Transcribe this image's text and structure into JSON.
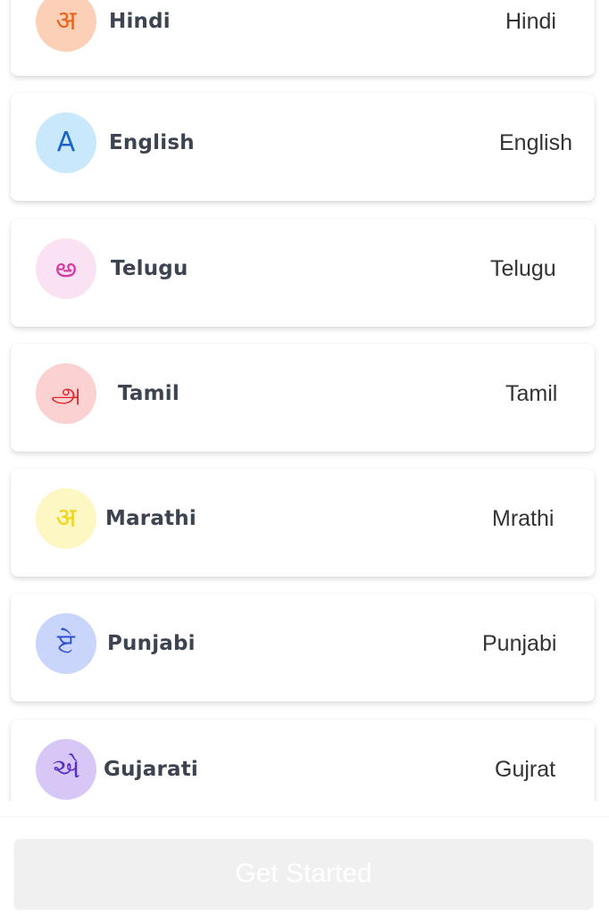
{
  "languages": [
    {
      "glyph": "अ",
      "name": "Hindi",
      "native": "Hindi",
      "glyph_color": "#e8661c",
      "bg_color": "#fbd0b6"
    },
    {
      "glyph": "A",
      "name": "English",
      "native": "English",
      "glyph_color": "#1a64c8",
      "bg_color": "#c9e8fb"
    },
    {
      "glyph": "అ",
      "name": "Telugu",
      "native": "Telugu",
      "glyph_color": "#d23ea6",
      "bg_color": "#fbe2f3"
    },
    {
      "glyph": "அ",
      "name": "Tamil",
      "native": "Tamil",
      "glyph_color": "#e0262b",
      "bg_color": "#fbd1d1"
    },
    {
      "glyph": "अ",
      "name": "Marathi",
      "native": "Mrathi",
      "glyph_color": "#f2d21a",
      "bg_color": "#fdf7c4"
    },
    {
      "glyph": "ਏ",
      "name": "Punjabi",
      "native": "Punjabi",
      "glyph_color": "#2f4fd0",
      "bg_color": "#c9d5fb"
    },
    {
      "glyph": "એ",
      "name": "Gujarati",
      "native": "Gujrat",
      "glyph_color": "#5b2ec6",
      "bg_color": "#d6c7f7"
    }
  ],
  "footer": {
    "button_label": "Get Started",
    "button_bg": "#f0f0f0",
    "button_text_color": "#ffffff"
  }
}
